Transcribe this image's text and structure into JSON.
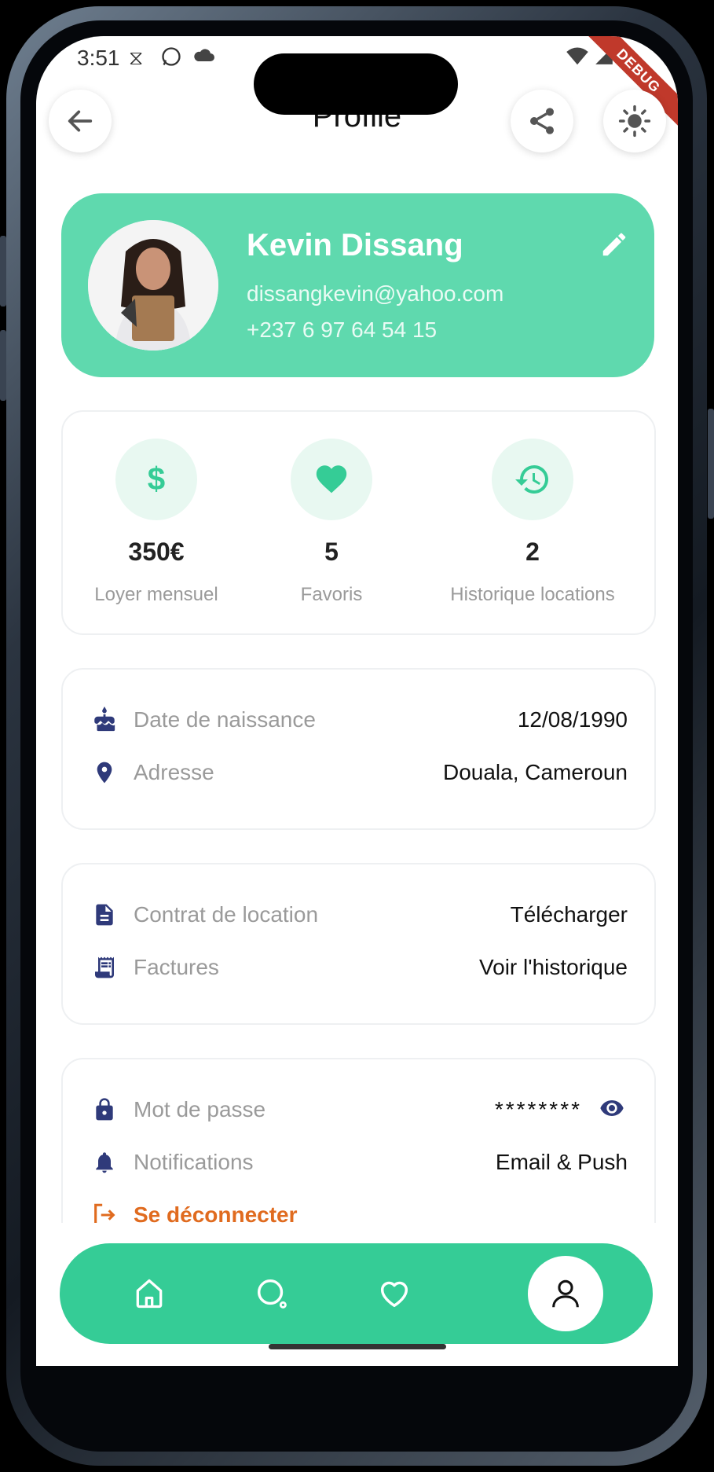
{
  "status_bar": {
    "time": "3:51"
  },
  "debug_banner": "DEBUG",
  "header": {
    "title": "Profile"
  },
  "profile": {
    "name": "Kevin Dissang",
    "email": "dissangkevin@yahoo.com",
    "phone": "+237 6 97 64 54 15"
  },
  "stats": [
    {
      "icon": "dollar-icon",
      "value": "350€",
      "label": "Loyer mensuel"
    },
    {
      "icon": "heart-icon",
      "value": "5",
      "label": "Favoris"
    },
    {
      "icon": "history-icon",
      "value": "2",
      "label": "Historique locations"
    }
  ],
  "personal_info": [
    {
      "icon": "cake-icon",
      "label": "Date de naissance",
      "value": "12/08/1990"
    },
    {
      "icon": "location-pin-icon",
      "label": "Adresse",
      "value": "Douala, Cameroun"
    }
  ],
  "documents": [
    {
      "icon": "document-icon",
      "label": "Contrat de location",
      "value": "Télécharger"
    },
    {
      "icon": "receipt-icon",
      "label": "Factures",
      "value": "Voir l'historique"
    }
  ],
  "security": [
    {
      "icon": "lock-icon",
      "label": "Mot de passe",
      "value": "********"
    },
    {
      "icon": "bell-icon",
      "label": "Notifications",
      "value": "Email & Push"
    },
    {
      "icon": "logout-icon",
      "label": "Se déconnecter"
    }
  ],
  "bottom_nav": [
    "home-icon",
    "search-icon",
    "heart-outline-icon",
    "profile-icon"
  ],
  "colors": {
    "accent": "#35cc96",
    "card": "#5fd9ae",
    "icon_primary": "#2f3a7a",
    "logout": "#e06b1f"
  }
}
